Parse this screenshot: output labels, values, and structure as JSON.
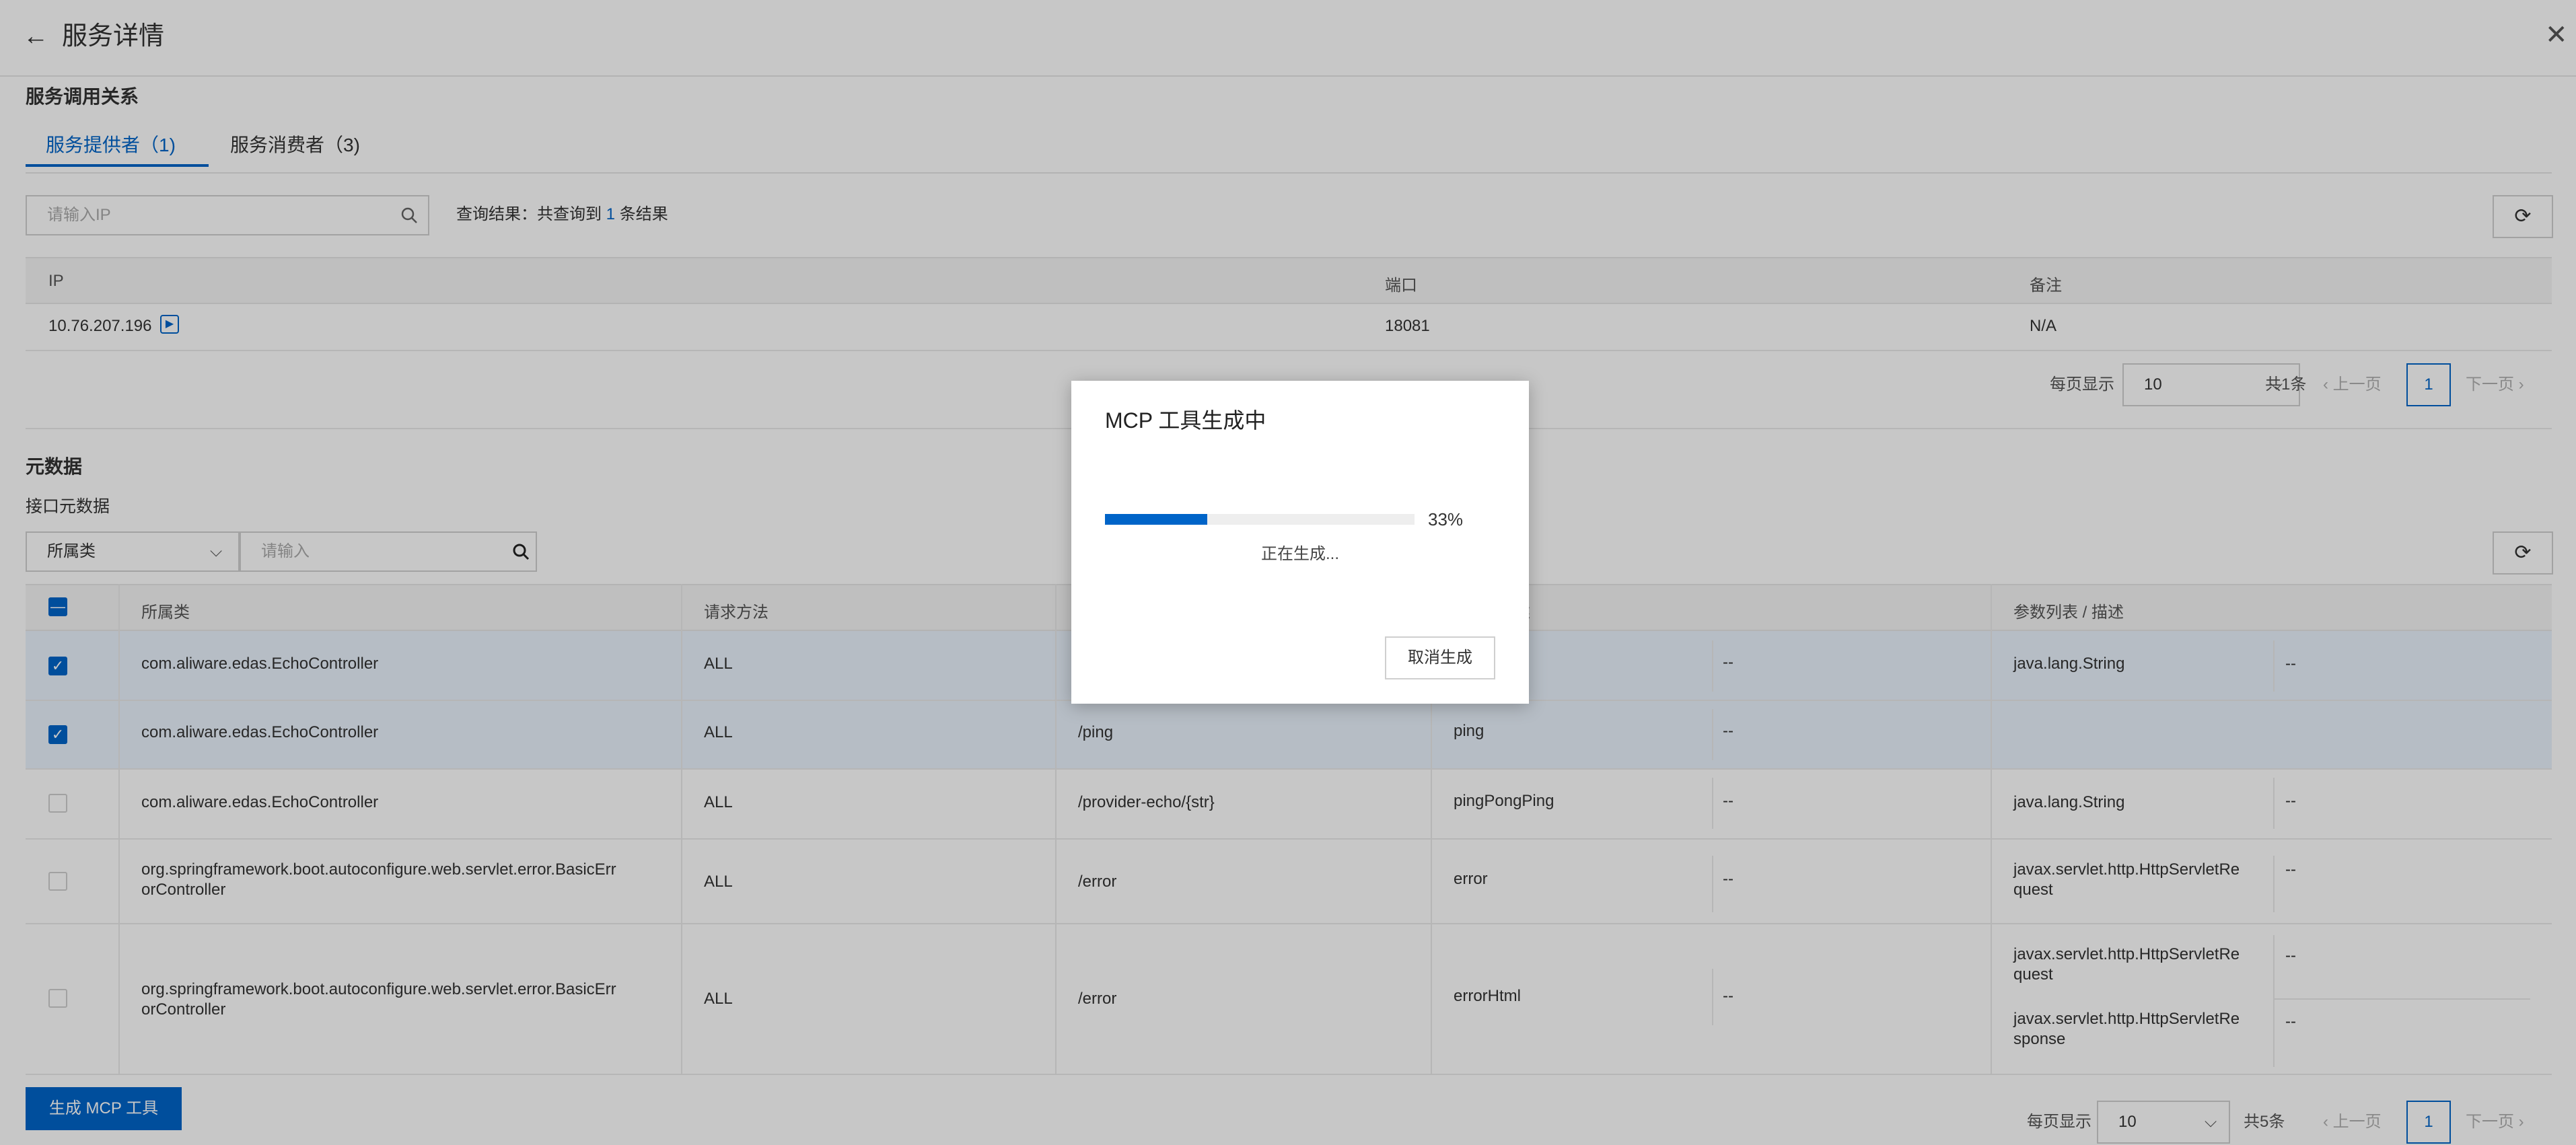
{
  "header": {
    "title": "服务详情",
    "back_icon": "←",
    "close_icon": "✕"
  },
  "relations": {
    "title": "服务调用关系",
    "tabs": [
      {
        "label": "服务提供者（1)"
      },
      {
        "label": "服务消费者（3)"
      }
    ],
    "search": {
      "placeholder": "请输入IP"
    },
    "result_prefix": "查询结果：共查询到",
    "result_count": "1",
    "result_suffix": "条结果",
    "columns": [
      "IP",
      "端口",
      "备注"
    ],
    "rows": [
      {
        "ip": "10.76.207.196",
        "port": "18081",
        "note": "N/A"
      }
    ],
    "pagination": {
      "per_page_label": "每页显示",
      "per_page": "10",
      "total": "共1条",
      "prev": "上一页",
      "page": "1",
      "next": "下一页"
    }
  },
  "metadata": {
    "title": "元数据",
    "subtitle": "接口元数据",
    "filter_select": "所属类",
    "filter_placeholder": "请输入",
    "columns": [
      "所属类",
      "请求方法",
      "",
      "述",
      "参数列表 / 描述"
    ],
    "rows": [
      {
        "class": "com.aliware.edas.EchoController",
        "method": "ALL",
        "path": "",
        "name": "",
        "desc": "--",
        "params": [
          {
            "type": "java.lang.String",
            "desc": "--"
          }
        ],
        "checked": true
      },
      {
        "class": "com.aliware.edas.EchoController",
        "method": "ALL",
        "path": "/ping",
        "name": "ping",
        "desc": "--",
        "params": [],
        "checked": true
      },
      {
        "class": "com.aliware.edas.EchoController",
        "method": "ALL",
        "path": "/provider-echo/{str}",
        "name": "pingPongPing",
        "desc": "--",
        "params": [
          {
            "type": "java.lang.String",
            "desc": "--"
          }
        ],
        "checked": false
      },
      {
        "class": [
          "org.springframework.boot.autoconfigure.web.servlet.error.BasicErr",
          "orController"
        ],
        "method": "ALL",
        "path": "/error",
        "name": "error",
        "desc": "--",
        "params": [
          {
            "type": [
              "javax.servlet.http.HttpServletRe",
              "quest"
            ],
            "desc": "--"
          }
        ],
        "checked": false
      },
      {
        "class": [
          "org.springframework.boot.autoconfigure.web.servlet.error.BasicErr",
          "orController"
        ],
        "method": "ALL",
        "path": "/error",
        "name": "errorHtml",
        "desc": "--",
        "params": [
          {
            "type": [
              "javax.servlet.http.HttpServletRe",
              "quest"
            ],
            "desc": "--"
          },
          {
            "type": [
              "javax.servlet.http.HttpServletRe",
              "sponse"
            ],
            "desc": "--"
          }
        ],
        "checked": false
      }
    ],
    "generate_button": "生成 MCP 工具",
    "pagination": {
      "per_page_label": "每页显示",
      "per_page": "10",
      "total": "共5条",
      "prev": "上一页",
      "page": "1",
      "next": "下一页"
    }
  },
  "modal": {
    "title": "MCP 工具生成中",
    "progress_percent": 33,
    "progress_label": "33%",
    "status": "正在生成...",
    "cancel_label": "取消生成"
  }
}
